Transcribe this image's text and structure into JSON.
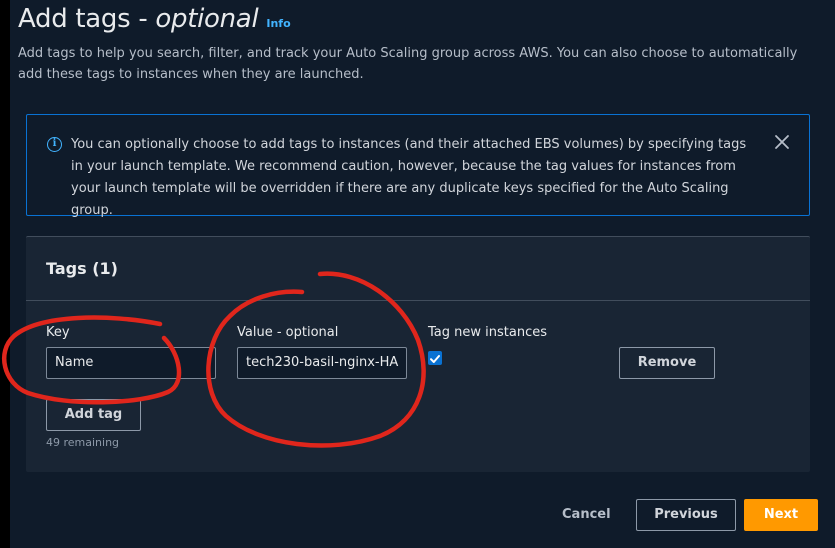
{
  "header": {
    "title_prefix": "Add tags - ",
    "title_italic": "optional",
    "info_link": "Info",
    "description": "Add tags to help you search, filter, and track your Auto Scaling group across AWS. You can also choose to automatically add these tags to instances when they are launched."
  },
  "alert": {
    "icon": "info-circle-icon",
    "text": "You can optionally choose to add tags to instances (and their attached EBS volumes) by specifying tags in your launch template. We recommend caution, however, because the tag values for instances from your launch template will be overridden if there are any duplicate keys specified for the Auto Scaling group."
  },
  "tags_panel": {
    "title": "Tags (1)",
    "key_label": "Key",
    "value_label": "Value - optional",
    "tag_new_instances_label": "Tag new instances",
    "rows": [
      {
        "key": "Name",
        "value": "tech230-basil-nginx-HA",
        "tag_new_instances": true
      }
    ],
    "remove_label": "Remove",
    "add_tag_label": "Add tag",
    "remaining_text": "49 remaining"
  },
  "footer": {
    "cancel_label": "Cancel",
    "previous_label": "Previous",
    "next_label": "Next"
  },
  "colors": {
    "accent_orange": "#ff9900",
    "link_blue": "#42b4ff",
    "checkbox_blue": "#0972d3",
    "annotation_red": "#e0261c"
  }
}
